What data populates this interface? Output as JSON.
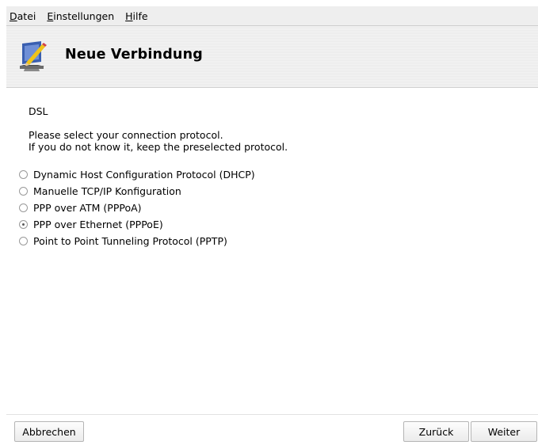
{
  "menubar": {
    "items": [
      {
        "mnemonic": "D",
        "rest": "atei"
      },
      {
        "mnemonic": "E",
        "rest": "instellungen"
      },
      {
        "mnemonic": "H",
        "rest": "ilfe"
      }
    ]
  },
  "header": {
    "title": "Neue Verbindung",
    "icon": "wizard-pencil-monitor-icon"
  },
  "content": {
    "connection_type": "DSL",
    "instruction_line1": "Please select your connection protocol.",
    "instruction_line2": "If you do not know it, keep the preselected protocol.",
    "options": [
      {
        "label": "Dynamic Host Configuration Protocol (DHCP)",
        "selected": false
      },
      {
        "label": "Manuelle TCP/IP Konfiguration",
        "selected": false
      },
      {
        "label": "PPP over ATM (PPPoA)",
        "selected": false
      },
      {
        "label": "PPP over Ethernet (PPPoE)",
        "selected": true
      },
      {
        "label": "Point to Point Tunneling Protocol (PPTP)",
        "selected": false
      }
    ]
  },
  "footer": {
    "cancel_label": "Abbrechen",
    "back_label": "Zurück",
    "next_label": "Weiter"
  },
  "colors": {
    "menubar_bg": "#eeeeee",
    "header_bg": "#efefef",
    "icon_blue": "#3a5fb0",
    "icon_yellow": "#f0c419"
  }
}
